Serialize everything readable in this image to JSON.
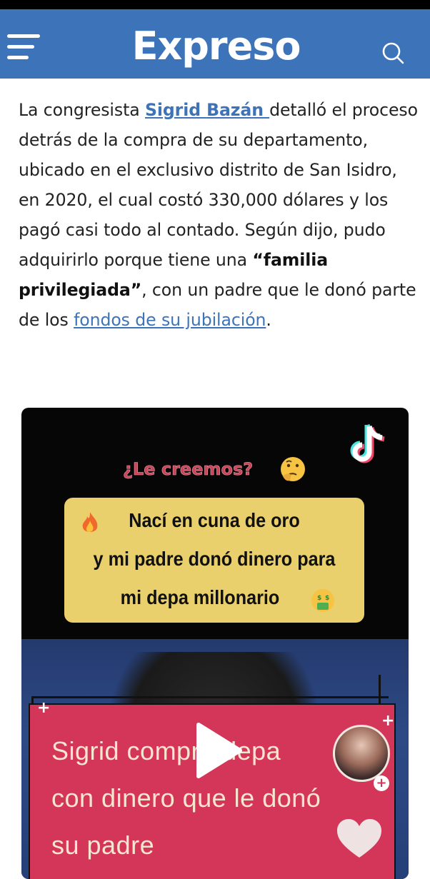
{
  "header": {
    "logo": "Expreso",
    "menu_icon": "hamburger-menu-icon",
    "search_icon": "search-icon",
    "background_color": "#3d74b9"
  },
  "article": {
    "p1_before": "La congresista ",
    "person_link": "Sigrid Bazán ",
    "p1_after": "detalló el proceso detrás de la compra de su departamento, ubicado en el exclusivo distrito de San Isidro, en 2020, el cual costó 330,000 dólares y los pagó casi todo al contado. Según dijo, pudo adquirirlo porque tiene una ",
    "quote_open": "“",
    "bold_phrase": "familia privilegiada",
    "quote_close": "”",
    "p1_mid": ", con un padre que le donó parte de los ",
    "link2": "fondos de su jubilación",
    "p1_end": ".",
    "link_color": "#3d74b9"
  },
  "video": {
    "tiktok_icon": "tiktok-logo-icon",
    "question": "¿Le creemos?",
    "think_emoji": "thinking-face-icon",
    "gold_line1": "Nací en cuna de oro",
    "gold_line2": "y mi padre donó dinero para",
    "gold_line3": "mi depa millonario",
    "fire_emoji": "fire-icon",
    "money_emoji": "money-mouth-face-icon",
    "pink_line1": "Sigrid compró depa",
    "pink_line2": "con dinero que le donó",
    "pink_line3": "su padre",
    "play_icon": "play-icon",
    "heart_icon": "heart-icon",
    "avatar": "creator-avatar",
    "avatar_plus": "+",
    "sparkle": "+",
    "pink_color": "#d4365a",
    "gold_color": "#e9d06c"
  }
}
